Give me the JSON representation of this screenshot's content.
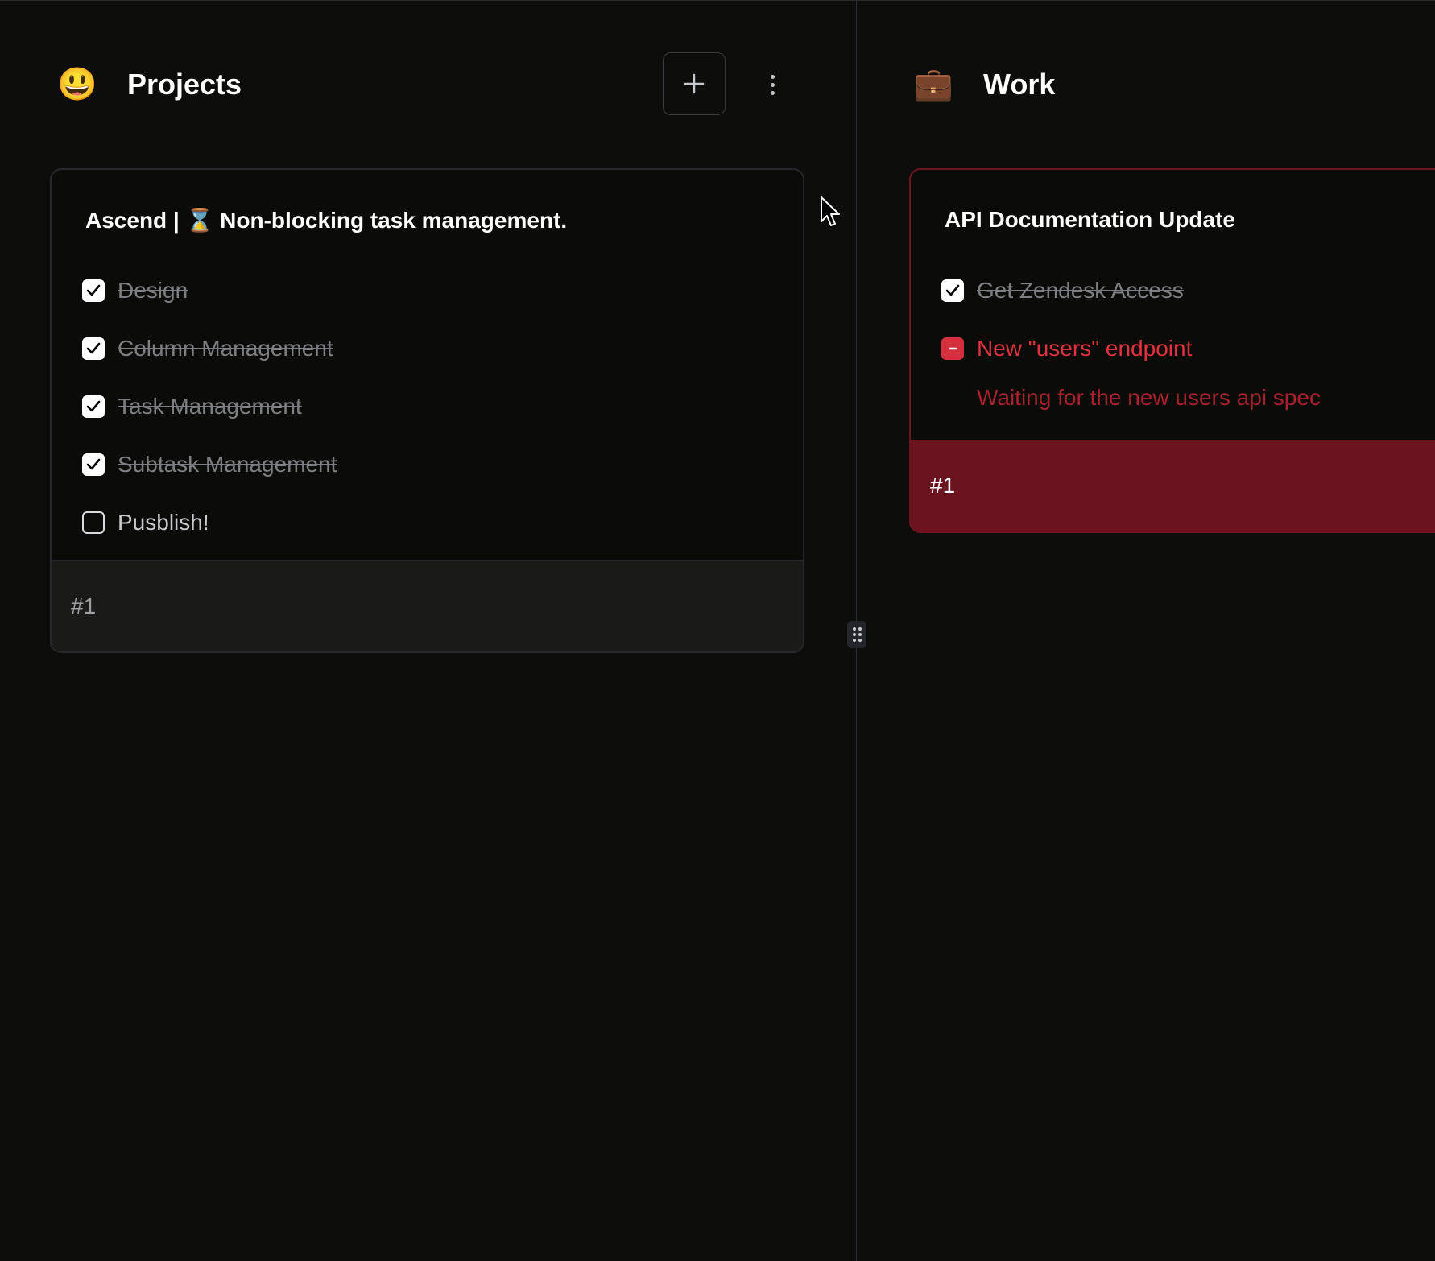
{
  "columns": [
    {
      "emoji": "😃",
      "title": "Projects",
      "card": {
        "title": "Ascend | ⌛ Non-blocking task management.",
        "tasks": [
          {
            "label": "Design",
            "status": "done"
          },
          {
            "label": "Column Management",
            "status": "done"
          },
          {
            "label": "Task Management",
            "status": "done"
          },
          {
            "label": "Subtask Management",
            "status": "done"
          },
          {
            "label": "Pusblish!",
            "status": "open"
          }
        ],
        "footer": "#1"
      }
    },
    {
      "emoji": "💼",
      "title": "Work",
      "card": {
        "title": "API Documentation Update",
        "tasks": [
          {
            "label": "Get Zendesk Access",
            "status": "done"
          },
          {
            "label": "New \"users\" endpoint",
            "status": "blocked",
            "note": "Waiting for the new users api spec"
          }
        ],
        "footer": "#1"
      }
    }
  ],
  "icons": {
    "add": "plus-icon",
    "more": "more-vertical-icon",
    "checked": "checkmark-icon",
    "blocked": "minus-icon",
    "resize": "drag-handle-icon",
    "cursor": "mouse-pointer-icon"
  },
  "colors": {
    "background": "#0d0e0b",
    "blocked_accent": "#e0323e",
    "blocked_footer": "#6b1420",
    "blocked_note": "#a9212c"
  }
}
